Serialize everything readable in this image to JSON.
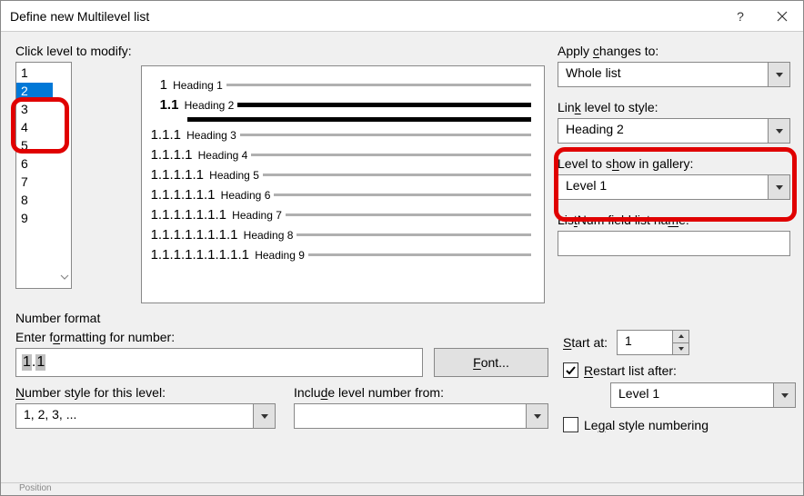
{
  "title": "Define new Multilevel list",
  "click_level_label": "Click level to modify:",
  "levels": [
    "1",
    "2",
    "3",
    "4",
    "5",
    "6",
    "7",
    "8",
    "9"
  ],
  "selected_level": "2",
  "preview": [
    {
      "indent": 10,
      "num": "1",
      "head": "Heading 1"
    },
    {
      "indent": 10,
      "num": "1.1",
      "head": "Heading 2",
      "bold": true,
      "thick": true,
      "extra": true
    },
    {
      "indent": 0,
      "num": "1.1.1",
      "head": "Heading 3"
    },
    {
      "indent": 0,
      "num": "1.1.1.1",
      "head": "Heading 4"
    },
    {
      "indent": 0,
      "num": "1.1.1.1.1",
      "head": "Heading 5"
    },
    {
      "indent": 0,
      "num": "1.1.1.1.1.1",
      "head": "Heading 6"
    },
    {
      "indent": 0,
      "num": "1.1.1.1.1.1.1",
      "head": "Heading 7"
    },
    {
      "indent": 0,
      "num": "1.1.1.1.1.1.1.1",
      "head": "Heading 8"
    },
    {
      "indent": 0,
      "num": "1.1.1.1.1.1.1.1.1",
      "head": "Heading 9"
    }
  ],
  "right": {
    "apply_label": "Apply changes to:",
    "apply_value": "Whole list",
    "link_label": "Link level to style:",
    "link_value": "Heading 2",
    "gallery_label": "Level to show in gallery:",
    "gallery_value": "Level 1",
    "listnum_label": "ListNum field list name:",
    "listnum_value": ""
  },
  "number_format_label": "Number format",
  "enter_formatting_label": "Enter formatting for number:",
  "enter_formatting_value_a": "1",
  "enter_formatting_value_b": ".",
  "enter_formatting_value_c": "1",
  "font_button": "Font...",
  "number_style_label": "Number style for this level:",
  "number_style_value": "1, 2, 3, ...",
  "include_from_label": "Include level number from:",
  "include_from_value": "",
  "start_at_label": "Start at:",
  "start_at_value": "1",
  "restart_label": "Restart list after:",
  "restart_checked": true,
  "restart_value": "Level 1",
  "legal_label": "Legal style numbering",
  "legal_checked": false,
  "position_label": "Position"
}
